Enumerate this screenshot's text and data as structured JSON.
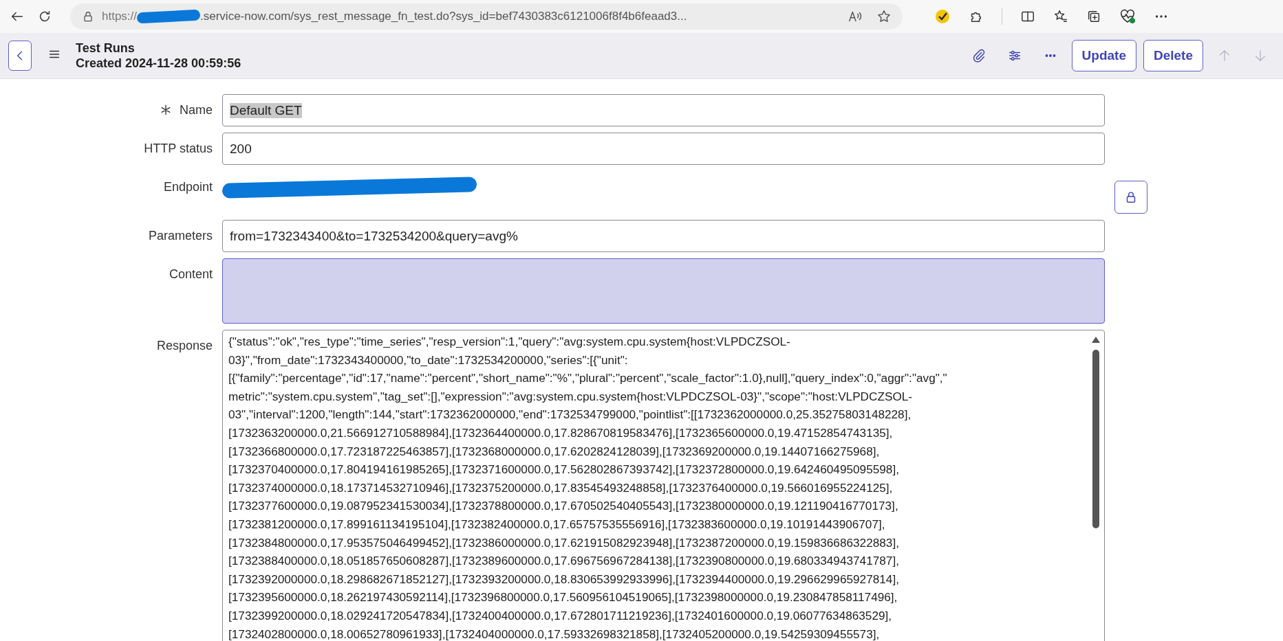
{
  "browser": {
    "address_prefix": "https://",
    "address_rest": ".service-now.com/sys_rest_message_fn_test.do?sys_id=bef7430383c6121006f8f4b6feaad3...",
    "address_redacted": true
  },
  "header": {
    "title": "Test Runs",
    "subtitle": "Created 2024-11-28 00:59:56",
    "buttons": [
      {
        "label": "Update"
      },
      {
        "label": "Delete"
      }
    ],
    "nav": [
      {
        "kind": "up",
        "disabled": true
      },
      {
        "kind": "down",
        "disabled": true
      }
    ]
  },
  "fields": [
    {
      "kind": "input",
      "label": "Name",
      "required": true,
      "value": "Default GET",
      "text_selected": true
    },
    {
      "kind": "input",
      "label": "HTTP status",
      "required": false,
      "value": "200",
      "text_selected": false
    },
    {
      "kind": "redacted",
      "label": "Endpoint",
      "required": false,
      "locked": true
    },
    {
      "kind": "input",
      "label": "Parameters",
      "required": false,
      "value": "from=1732343400&to=1732534200&query=avg%",
      "text_selected": false
    },
    {
      "kind": "area",
      "label": "Content",
      "required": false,
      "highlighted": true
    },
    {
      "kind": "response",
      "label": "Response",
      "required": false,
      "lines": [
        "{\"status\":\"ok\",\"res_type\":\"time_series\",\"resp_version\":1,\"query\":\"avg:system.cpu.system{host:VLPDCZSOL-",
        "03}\",\"from_date\":1732343400000,\"to_date\":1732534200000,\"series\":[{\"unit\":",
        "[{\"family\":\"percentage\",\"id\":17,\"name\":\"percent\",\"short_name\":\"%\",\"plural\":\"percent\",\"scale_factor\":1.0},null],\"query_index\":0,\"aggr\":\"avg\",\"",
        "metric\":\"system.cpu.system\",\"tag_set\":[],\"expression\":\"avg:system.cpu.system{host:VLPDCZSOL-03}\",\"scope\":\"host:VLPDCZSOL-",
        "03\",\"interval\":1200,\"length\":144,\"start\":1732362000000,\"end\":1732534799000,\"pointlist\":[[1732362000000.0,25.35275803148228],",
        "[1732363200000.0,21.566912710588984],[1732364400000.0,17.828670819583476],[1732365600000.0,19.47152854743135],",
        "[1732366800000.0,17.723187225463857],[1732368000000.0,17.6202824128039],[1732369200000.0,19.14407166275968],",
        "[1732370400000.0,17.804194161985265],[1732371600000.0,17.562802867393742],[1732372800000.0,19.642460495095598],",
        "[1732374000000.0,18.173714532710946],[1732375200000.0,17.83545493248858],[1732376400000.0,19.566016955224125],",
        "[1732377600000.0,19.087952341530034],[1732378800000.0,17.670502540405543],[1732380000000.0,19.121190416770173],",
        "[1732381200000.0,17.899161134195104],[1732382400000.0,17.65757535556916],[1732383600000.0,19.10191443906707],",
        "[1732384800000.0,17.953575046499452],[1732386000000.0,17.621915082923948],[1732387200000.0,19.159836686322883],",
        "[1732388400000.0,18.051857650608287],[1732389600000.0,17.696756967284138],[1732390800000.0,19.680334943741787],",
        "[1732392000000.0,18.298682671852127],[1732393200000.0,18.830653992933996],[1732394400000.0,19.296629965927814],",
        "[1732395600000.0,18.262197430592114],[1732396800000.0,17.560956104519065],[1732398000000.0,19.230847858117496],",
        "[1732399200000.0,18.029241720547834],[1732400400000.0,17.672801711219236],[1732401600000.0,19.06077634863529],",
        "[1732402800000.0,18.00652780961933],[1732404000000.0,17.59332698321858],[1732405200000.0,19.54259309455573],"
      ]
    }
  ]
}
